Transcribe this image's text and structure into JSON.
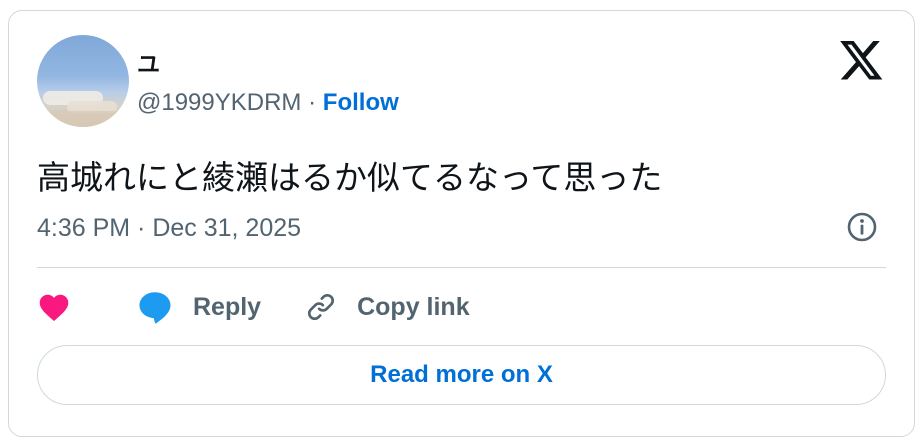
{
  "author": {
    "display_name": "ユ",
    "handle": "@1999YKDRM",
    "separator": "·",
    "follow_label": "Follow"
  },
  "tweet": {
    "text": "高城れにと綾瀬はるか似てるなって思った",
    "timestamp": "4:36 PM · Dec 31, 2025"
  },
  "actions": {
    "reply_label": "Reply",
    "copy_label": "Copy link"
  },
  "footer": {
    "read_more_label": "Read more on X"
  },
  "colors": {
    "link": "#006fd6",
    "heart": "#f91880",
    "reply_bubble": "#1d9bf0",
    "muted": "#536471",
    "border": "#cfd9de"
  },
  "icons": [
    "x-logo-icon",
    "info-icon",
    "heart-icon",
    "reply-bubble-icon",
    "link-icon"
  ]
}
